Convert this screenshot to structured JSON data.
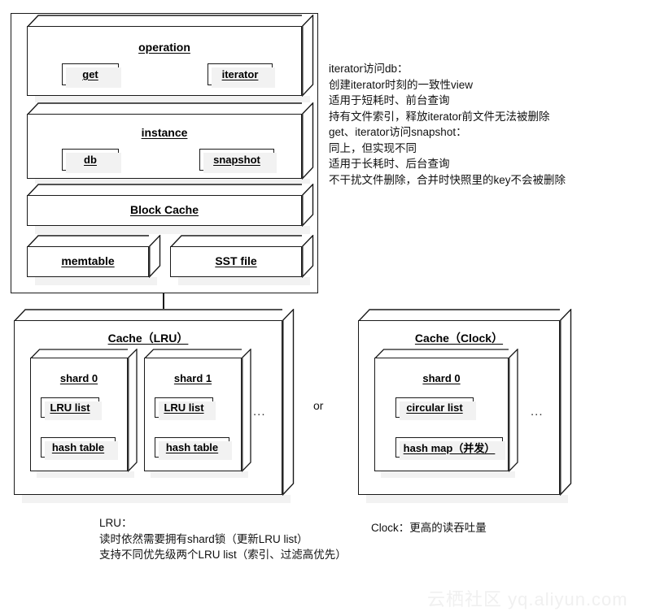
{
  "diagram": {
    "title_hidden": "RocksDB cache architecture diagram",
    "outer_container": {
      "name": "reader-stack-container"
    },
    "top_stack": [
      {
        "id": "operation",
        "label": "operation",
        "chips": [
          {
            "id": "get",
            "label": "get"
          },
          {
            "id": "iterator",
            "label": "iterator"
          }
        ]
      },
      {
        "id": "instance",
        "label": "instance",
        "chips": [
          {
            "id": "db",
            "label": "db"
          },
          {
            "id": "snapshot",
            "label": "snapshot"
          }
        ]
      },
      {
        "id": "block-cache",
        "label": "Block Cache",
        "chips": []
      }
    ],
    "storage_row": [
      {
        "id": "memtable",
        "label": "memtable"
      },
      {
        "id": "sst-file",
        "label": "SST file"
      }
    ],
    "notes_top": "iterator访问db：\n创建iterator时刻的一致性view\n适用于短耗时、前台查询\n持有文件索引，释放iterator前文件无法被删除\nget、iterator访问snapshot：\n同上，但实现不同\n适用于长耗时、后台查询\n不干扰文件删除，合并时快照里的key不会被删除",
    "cache_lru": {
      "id": "cache-lru",
      "label": "Cache（LRU）",
      "ellipsis": "...",
      "shards": [
        {
          "id": "shard-0",
          "label": "shard 0",
          "items": [
            {
              "id": "lru-list",
              "label": "LRU list"
            },
            {
              "id": "hash-table",
              "label": "hash table"
            }
          ]
        },
        {
          "id": "shard-1",
          "label": "shard 1",
          "items": [
            {
              "id": "lru-list",
              "label": "LRU list"
            },
            {
              "id": "hash-table",
              "label": "hash table"
            }
          ]
        }
      ]
    },
    "separator": {
      "id": "or-separator",
      "label": "or"
    },
    "cache_clock": {
      "id": "cache-clock",
      "label": "Cache（Clock）",
      "ellipsis": "...",
      "shards": [
        {
          "id": "shard-0",
          "label": "shard 0",
          "items": [
            {
              "id": "circular-list",
              "label": "circular list"
            },
            {
              "id": "hash-map",
              "label": "hash map（并发）"
            }
          ]
        }
      ]
    },
    "notes_lru": "LRU：\n读时依然需要拥有shard锁（更新LRU list）\n支持不同优先级两个LRU list（索引、过滤高优先）",
    "notes_clock": "Clock：更高的读吞吐量",
    "watermark": "云栖社区 yq.aliyun.com"
  },
  "colors": {
    "stroke": "#1a1a1a",
    "fill": "#ffffff",
    "shadow": "#f2f2f2",
    "text": "#111111",
    "watermark": "#f0f0f0"
  }
}
